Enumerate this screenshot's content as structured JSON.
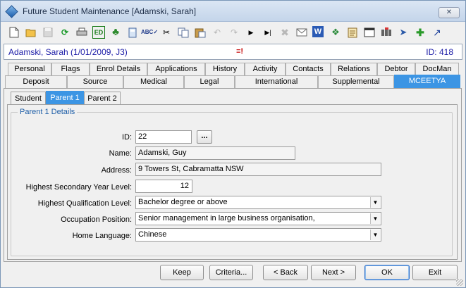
{
  "window": {
    "title": "Future Student Maintenance  [Adamski, Sarah]",
    "close_label": "✕"
  },
  "toolbar": {
    "icons": [
      "new-icon",
      "open-icon",
      "save-icon",
      "refresh-icon",
      "print-icon",
      "edit-icon",
      "tree-icon",
      "calculator-icon",
      "spellcheck-icon",
      "cut-icon",
      "copy-icon",
      "paste-icon",
      "undo-icon",
      "redo-icon",
      "next-record-icon",
      "last-record-icon",
      "delete-icon",
      "mail-icon",
      "word-icon",
      "excel-icon",
      "notes-icon",
      "calendar-icon",
      "barcode-icon",
      "tag-icon",
      "add-note-icon",
      "wand-icon"
    ]
  },
  "student_bar": {
    "name": "Adamski, Sarah (1/01/2009, J3)",
    "id_text": "ID: 418"
  },
  "tabs_row1": [
    "Personal",
    "Flags",
    "Enrol Details",
    "Applications",
    "History",
    "Activity",
    "Contacts",
    "Relations",
    "Debtor",
    "DocMan"
  ],
  "tabs_row2": [
    "Deposit",
    "Source",
    "Medical",
    "Legal",
    "International",
    "Supplemental",
    "MCEETYA"
  ],
  "active_tab": "MCEETYA",
  "subtabs": [
    "Student",
    "Parent 1",
    "Parent 2"
  ],
  "active_subtab": "Parent 1",
  "group": {
    "title": "Parent 1 Details"
  },
  "form": {
    "id_label": "ID:",
    "id_value": "22",
    "lookup_label": "...",
    "name_label": "Name:",
    "name_value": "Adamski, Guy",
    "address_label": "Address:",
    "address_value": "9 Towers St, Cabramatta NSW",
    "secondary_label": "Highest Secondary Year Level:",
    "secondary_value": "12",
    "qualification_label": "Highest Qualification Level:",
    "qualification_value": "Bachelor degree or above",
    "occupation_label": "Occupation Position:",
    "occupation_value": "Senior management in large business organisation,",
    "language_label": "Home Language:",
    "language_value": "Chinese"
  },
  "buttons": {
    "keep": "Keep",
    "criteria": "Criteria...",
    "back": "< Back",
    "next": "Next >",
    "ok": "OK",
    "exit": "Exit"
  },
  "colors": {
    "active_tab": "#3c95e4",
    "student_text": "#1a1aa6",
    "group_title": "#1f5fa8"
  }
}
